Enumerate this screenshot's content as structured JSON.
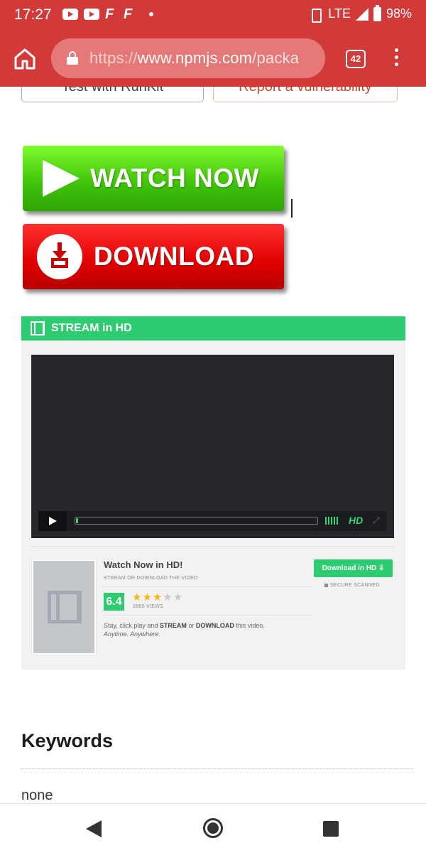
{
  "status_bar": {
    "time": "17:27",
    "network": "LTE",
    "battery": "98%"
  },
  "browser": {
    "url_scheme": "https://",
    "url_host": "www.npmjs.com",
    "url_path": "/packa",
    "tab_count": "42",
    "theme_color": "#d23a3a"
  },
  "page": {
    "top_buttons": {
      "runkit": "Test with RunKit",
      "vulnerability": "Report a vulnerability"
    },
    "watch_now_label": "WATCH NOW",
    "download_label": "DOWNLOAD",
    "stream": {
      "header": "STREAM in HD",
      "progress_fraction": 0.01,
      "hd_label": "HD",
      "info_title": "Watch Now in HD!",
      "info_subtitle": "STREAM OR DOWNLOAD THE VIDEO",
      "rating": "6.4",
      "stars_filled": 3,
      "stars_total": 5,
      "views": "2865 VIEWS",
      "desc_prefix": "Stay, click play and ",
      "desc_stream": "STREAM",
      "desc_or": " or ",
      "desc_download": "DOWNLOAD",
      "desc_suffix": " this video.",
      "desc_tagline": "Anytime. Anywhere.",
      "download_hd_button": "Download in HD ⇩",
      "secure_label": "SECURE SCANNED"
    },
    "keywords": {
      "title": "Keywords",
      "value": "none"
    }
  }
}
